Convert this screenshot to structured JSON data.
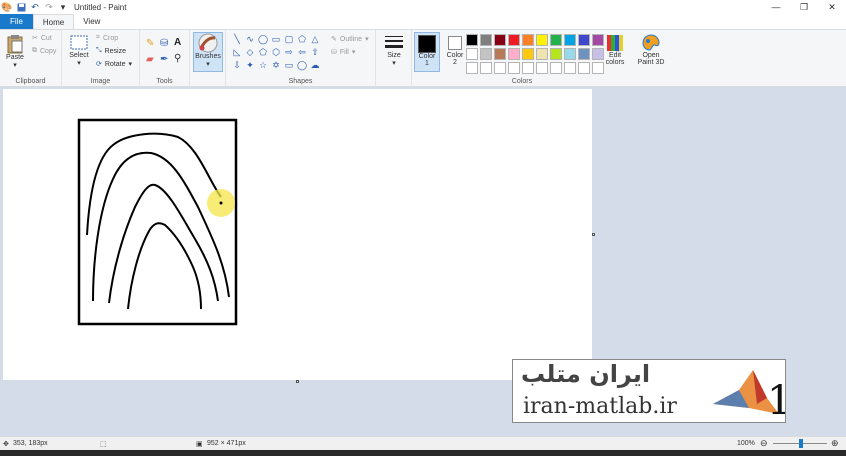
{
  "window": {
    "title": "Untitled - Paint"
  },
  "tabs": [
    {
      "label": "File"
    },
    {
      "label": "Home"
    },
    {
      "label": "View"
    }
  ],
  "clipboard": {
    "paste": "Paste",
    "cut": "Cut",
    "copy": "Copy",
    "group": "Clipboard"
  },
  "image": {
    "select": "Select",
    "crop": "Crop",
    "resize": "Resize",
    "rotate": "Rotate",
    "group": "Image"
  },
  "tools": {
    "group": "Tools"
  },
  "brushes": {
    "label": "Brushes"
  },
  "shapes": {
    "outline": "Outline",
    "fill": "Fill",
    "group": "Shapes"
  },
  "size": {
    "label": "Size"
  },
  "colors": {
    "color1_label": "Color",
    "color1_num": "1",
    "color2_label": "Color",
    "color2_num": "2",
    "edit_label": "Edit",
    "edit_label2": "colors",
    "paint3d_label": "Open",
    "paint3d_label2": "Paint 3D",
    "group": "Colors",
    "color1_value": "#000000",
    "color2_value": "#ffffff",
    "palette": [
      "#000000",
      "#7f7f7f",
      "#880015",
      "#ed1c24",
      "#ff7f27",
      "#fff200",
      "#22b14c",
      "#00a2e8",
      "#3f48cc",
      "#a349a4",
      "#ffffff",
      "#c3c3c3",
      "#b97a57",
      "#ffaec9",
      "#ffc90e",
      "#efe4b0",
      "#b5e61d",
      "#99d9ea",
      "#7092be",
      "#c8bfe7",
      "#ffffff",
      "#ffffff",
      "#ffffff",
      "#ffffff",
      "#ffffff",
      "#ffffff",
      "#ffffff",
      "#ffffff",
      "#ffffff",
      "#ffffff"
    ]
  },
  "watermark": {
    "persian": "ایران متلب",
    "latin": "iran-matlab.ir"
  },
  "status": {
    "cursor_pos": "353, 183px",
    "canvas_size": "952 × 471px",
    "zoom": "100%"
  }
}
